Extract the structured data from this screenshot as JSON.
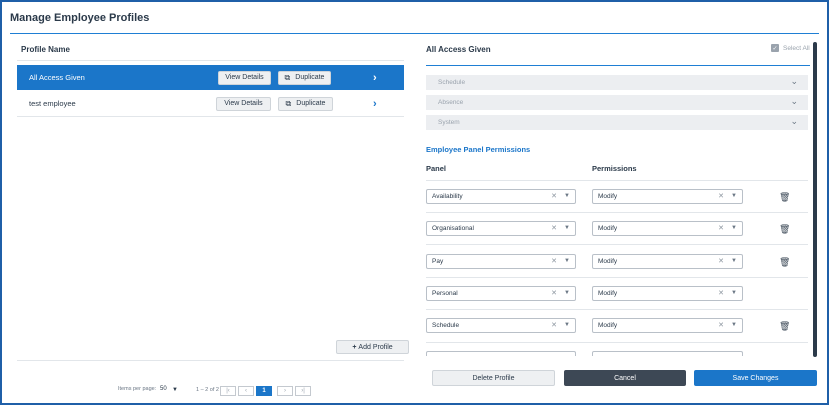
{
  "window": {
    "title": "Manage Employee Profiles"
  },
  "left": {
    "column_header": "Profile Name",
    "profiles": [
      {
        "name": "All Access Given",
        "view_label": "View Details",
        "duplicate_label": "Duplicate",
        "selected": true
      },
      {
        "name": "test employee",
        "view_label": "View Details",
        "duplicate_label": "Duplicate",
        "selected": false
      }
    ],
    "add_profile_label": "Add Profile",
    "pagination": {
      "items_per_page_label": "Items per page:",
      "items_per_page_value": "50",
      "range": "1 – 2 of 2",
      "current_page": "1"
    }
  },
  "right": {
    "header": "All Access Given",
    "select_all_label": "Select All",
    "accordions": [
      {
        "label": "Schedule"
      },
      {
        "label": "Absence"
      },
      {
        "label": "System"
      }
    ],
    "section_title": "Employee Panel Permissions",
    "table_headers": {
      "panel": "Panel",
      "permissions": "Permissions"
    },
    "rows": [
      {
        "panel": "Availability",
        "permission": "Modify",
        "deletable": true
      },
      {
        "panel": "Organisational",
        "permission": "Modify",
        "deletable": true
      },
      {
        "panel": "Pay",
        "permission": "Modify",
        "deletable": true
      },
      {
        "panel": "Personal",
        "permission": "Modify",
        "deletable": false
      },
      {
        "panel": "Schedule",
        "permission": "Modify",
        "deletable": true
      }
    ]
  },
  "footer": {
    "delete_label": "Delete Profile",
    "cancel_label": "Cancel",
    "save_label": "Save Changes"
  },
  "colors": {
    "accent": "#1b76c9",
    "dark_button": "#3d4855",
    "frame_border": "#1f5fa8"
  }
}
